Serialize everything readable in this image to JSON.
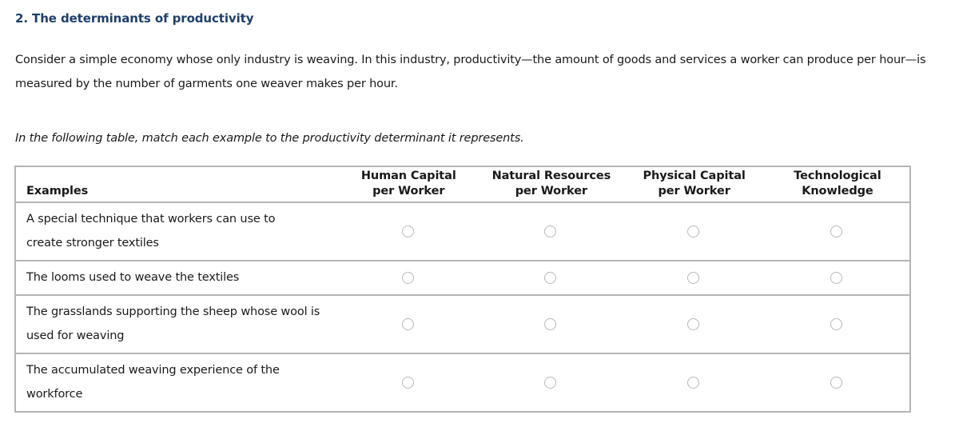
{
  "question": {
    "title": "2. The determinants of productivity",
    "intro": "Consider a simple economy whose only industry is weaving. In this industry, productivity—the amount of goods and services a worker can produce per hour—is measured by the number of garments one weaver makes per hour.",
    "instruction": "In the following table, match each example to the productivity determinant it represents."
  },
  "table": {
    "headers": {
      "examples": "Examples",
      "columns": [
        {
          "line1": "Human Capital",
          "line2": "per Worker"
        },
        {
          "line1": "Natural Resources",
          "line2": "per Worker"
        },
        {
          "line1": "Physical Capital",
          "line2": "per Worker"
        },
        {
          "line1": "Technological",
          "line2": "Knowledge"
        }
      ]
    },
    "rows": [
      {
        "example": "A special technique that workers can use to create stronger textiles",
        "selected": null
      },
      {
        "example": "The looms used to weave the textiles",
        "selected": null
      },
      {
        "example": "The grasslands supporting the sheep whose wool is used for weaving",
        "selected": null
      },
      {
        "example": "The accumulated weaving experience of the workforce",
        "selected": null
      }
    ]
  }
}
